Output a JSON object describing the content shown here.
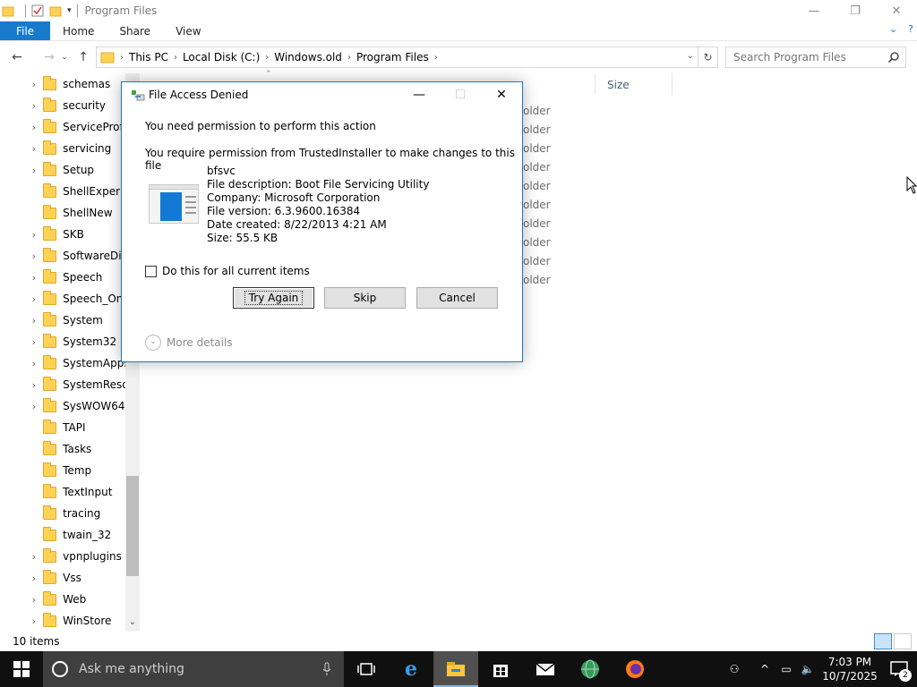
{
  "window": {
    "title": "Program Files",
    "controls": {
      "minimize": "—",
      "restore": "❐",
      "close": "✕"
    }
  },
  "ribbon": {
    "tabs": [
      {
        "label": "File"
      },
      {
        "label": "Home"
      },
      {
        "label": "Share"
      },
      {
        "label": "View"
      }
    ],
    "expand_icon": "⌄",
    "help_icon": "?"
  },
  "address": {
    "breadcrumbs": [
      "This PC",
      "Local Disk (C:)",
      "Windows.old",
      "Program Files"
    ],
    "search_placeholder": "Search Program Files"
  },
  "nav_pane": {
    "items": [
      {
        "label": "schemas",
        "expandable": true
      },
      {
        "label": "security",
        "expandable": true
      },
      {
        "label": "ServiceProfiles",
        "expandable": true
      },
      {
        "label": "servicing",
        "expandable": true
      },
      {
        "label": "Setup",
        "expandable": true
      },
      {
        "label": "ShellExperiences",
        "expandable": false
      },
      {
        "label": "ShellNew",
        "expandable": false
      },
      {
        "label": "SKB",
        "expandable": true
      },
      {
        "label": "SoftwareDistribution",
        "expandable": true
      },
      {
        "label": "Speech",
        "expandable": true
      },
      {
        "label": "Speech_OneCore",
        "expandable": true
      },
      {
        "label": "System",
        "expandable": true
      },
      {
        "label": "System32",
        "expandable": true
      },
      {
        "label": "SystemApps",
        "expandable": true
      },
      {
        "label": "SystemResources",
        "expandable": true
      },
      {
        "label": "SysWOW64",
        "expandable": true
      },
      {
        "label": "TAPI",
        "expandable": false
      },
      {
        "label": "Tasks",
        "expandable": false
      },
      {
        "label": "Temp",
        "expandable": false
      },
      {
        "label": "TextInput",
        "expandable": false
      },
      {
        "label": "tracing",
        "expandable": false
      },
      {
        "label": "twain_32",
        "expandable": false
      },
      {
        "label": "vpnplugins",
        "expandable": true
      },
      {
        "label": "Vss",
        "expandable": true
      },
      {
        "label": "Web",
        "expandable": true
      },
      {
        "label": "WinStore",
        "expandable": true
      }
    ]
  },
  "content": {
    "column_size": "Size",
    "row_type_fragment": "older",
    "row_count": 10
  },
  "status": {
    "item_count": "10 items"
  },
  "dialog": {
    "title": "File Access Denied",
    "line1": "You need permission to perform this action",
    "line2": "You require permission from TrustedInstaller to make changes to this file",
    "file_name": "bfsvc",
    "file_description": "File description: Boot File Servicing Utility",
    "company": "Company: Microsoft Corporation",
    "file_version": "File version: 6.3.9600.16384",
    "date_created": "Date created: 8/22/2013 4:21 AM",
    "size": "Size: 55.5 KB",
    "checkbox_label": "Do this for all current items",
    "checkbox_checked": false,
    "buttons": {
      "try_again": "Try Again",
      "skip": "Skip",
      "cancel": "Cancel"
    },
    "more_details": "More details"
  },
  "taskbar": {
    "search_placeholder": "Ask me anything",
    "time": "7:03 PM",
    "date": "10/7/2025",
    "notification_count": "2"
  },
  "colors": {
    "accent": "#1979ca",
    "taskbar": "#101010",
    "cortana": "#3f3f3f",
    "folder": "#ffd256"
  }
}
